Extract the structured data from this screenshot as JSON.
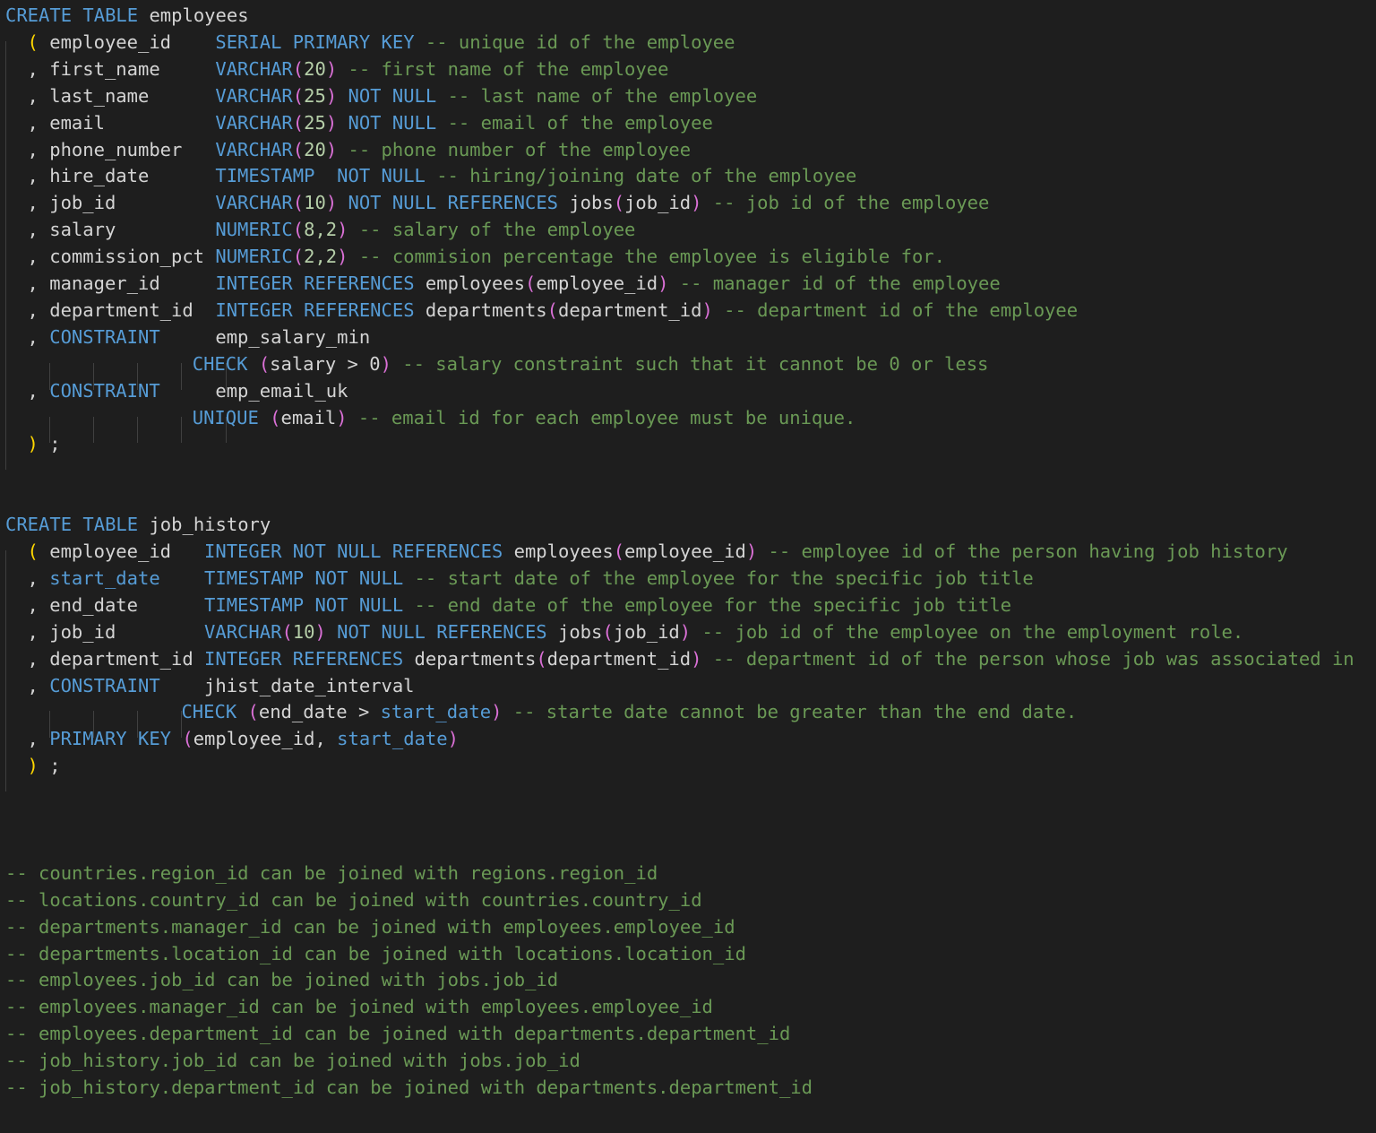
{
  "editor": {
    "language": "sql",
    "colors": {
      "background": "#1e1e1e",
      "keyword": "#569cd6",
      "identifier": "#d4d4d4",
      "number": "#b5cea8",
      "bracket_outer": "#ffd700",
      "bracket_inner": "#da70d6",
      "comment": "#6a9955",
      "indent_guide": "#404040"
    },
    "lines": [
      {
        "row": 0,
        "indent": 0,
        "tokens": [
          {
            "t": "CREATE TABLE",
            "c": "kw"
          },
          {
            "t": " employees",
            "c": "id"
          }
        ]
      },
      {
        "row": 1,
        "indent": 2,
        "tokens": [
          {
            "t": "( ",
            "c": "pb"
          },
          {
            "t": "employee_id    ",
            "c": "id"
          },
          {
            "t": "SERIAL PRIMARY KEY",
            "c": "kw"
          },
          {
            "t": " -- unique id of the employee",
            "c": "cm"
          }
        ]
      },
      {
        "row": 2,
        "indent": 2,
        "tokens": [
          {
            "t": ", ",
            "c": "pn"
          },
          {
            "t": "first_name     ",
            "c": "id"
          },
          {
            "t": "VARCHAR",
            "c": "kw"
          },
          {
            "t": "(",
            "c": "pp"
          },
          {
            "t": "20",
            "c": "nm"
          },
          {
            "t": ")",
            "c": "pp"
          },
          {
            "t": " -- first name of the employee",
            "c": "cm"
          }
        ]
      },
      {
        "row": 3,
        "indent": 2,
        "tokens": [
          {
            "t": ", ",
            "c": "pn"
          },
          {
            "t": "last_name      ",
            "c": "id"
          },
          {
            "t": "VARCHAR",
            "c": "kw"
          },
          {
            "t": "(",
            "c": "pp"
          },
          {
            "t": "25",
            "c": "nm"
          },
          {
            "t": ")",
            "c": "pp"
          },
          {
            "t": " NOT NULL",
            "c": "kw"
          },
          {
            "t": " -- last name of the employee",
            "c": "cm"
          }
        ]
      },
      {
        "row": 4,
        "indent": 2,
        "tokens": [
          {
            "t": ", ",
            "c": "pn"
          },
          {
            "t": "email          ",
            "c": "id"
          },
          {
            "t": "VARCHAR",
            "c": "kw"
          },
          {
            "t": "(",
            "c": "pp"
          },
          {
            "t": "25",
            "c": "nm"
          },
          {
            "t": ")",
            "c": "pp"
          },
          {
            "t": " NOT NULL",
            "c": "kw"
          },
          {
            "t": " -- email of the employee",
            "c": "cm"
          }
        ]
      },
      {
        "row": 5,
        "indent": 2,
        "tokens": [
          {
            "t": ", ",
            "c": "pn"
          },
          {
            "t": "phone_number   ",
            "c": "id"
          },
          {
            "t": "VARCHAR",
            "c": "kw"
          },
          {
            "t": "(",
            "c": "pp"
          },
          {
            "t": "20",
            "c": "nm"
          },
          {
            "t": ")",
            "c": "pp"
          },
          {
            "t": " -- phone number of the employee",
            "c": "cm"
          }
        ]
      },
      {
        "row": 6,
        "indent": 2,
        "tokens": [
          {
            "t": ", ",
            "c": "pn"
          },
          {
            "t": "hire_date      ",
            "c": "id"
          },
          {
            "t": "TIMESTAMP  NOT NULL",
            "c": "kw"
          },
          {
            "t": " -- hiring/joining date of the employee",
            "c": "cm"
          }
        ]
      },
      {
        "row": 7,
        "indent": 2,
        "tokens": [
          {
            "t": ", ",
            "c": "pn"
          },
          {
            "t": "job_id         ",
            "c": "id"
          },
          {
            "t": "VARCHAR",
            "c": "kw"
          },
          {
            "t": "(",
            "c": "pp"
          },
          {
            "t": "10",
            "c": "nm"
          },
          {
            "t": ")",
            "c": "pp"
          },
          {
            "t": " NOT NULL REFERENCES",
            "c": "kw"
          },
          {
            "t": " jobs",
            "c": "id"
          },
          {
            "t": "(",
            "c": "pp"
          },
          {
            "t": "job_id",
            "c": "id"
          },
          {
            "t": ")",
            "c": "pp"
          },
          {
            "t": " -- job id of the employee",
            "c": "cm"
          }
        ]
      },
      {
        "row": 8,
        "indent": 2,
        "tokens": [
          {
            "t": ", ",
            "c": "pn"
          },
          {
            "t": "salary         ",
            "c": "id"
          },
          {
            "t": "NUMERIC",
            "c": "kw"
          },
          {
            "t": "(",
            "c": "pp"
          },
          {
            "t": "8,2",
            "c": "nm"
          },
          {
            "t": ")",
            "c": "pp"
          },
          {
            "t": " -- salary of the employee",
            "c": "cm"
          }
        ]
      },
      {
        "row": 9,
        "indent": 2,
        "tokens": [
          {
            "t": ", ",
            "c": "pn"
          },
          {
            "t": "commission_pct ",
            "c": "id"
          },
          {
            "t": "NUMERIC",
            "c": "kw"
          },
          {
            "t": "(",
            "c": "pp"
          },
          {
            "t": "2,2",
            "c": "nm"
          },
          {
            "t": ")",
            "c": "pp"
          },
          {
            "t": " -- commision percentage the employee is eligible for.",
            "c": "cm"
          }
        ]
      },
      {
        "row": 10,
        "indent": 2,
        "tokens": [
          {
            "t": ", ",
            "c": "pn"
          },
          {
            "t": "manager_id     ",
            "c": "id"
          },
          {
            "t": "INTEGER REFERENCES",
            "c": "kw"
          },
          {
            "t": " employees",
            "c": "id"
          },
          {
            "t": "(",
            "c": "pp"
          },
          {
            "t": "employee_id",
            "c": "id"
          },
          {
            "t": ")",
            "c": "pp"
          },
          {
            "t": " -- manager id of the employee",
            "c": "cm"
          }
        ]
      },
      {
        "row": 11,
        "indent": 2,
        "tokens": [
          {
            "t": ", ",
            "c": "pn"
          },
          {
            "t": "department_id  ",
            "c": "id"
          },
          {
            "t": "INTEGER REFERENCES",
            "c": "kw"
          },
          {
            "t": " departments",
            "c": "id"
          },
          {
            "t": "(",
            "c": "pp"
          },
          {
            "t": "department_id",
            "c": "id"
          },
          {
            "t": ")",
            "c": "pp"
          },
          {
            "t": " -- department id of the employee",
            "c": "cm"
          }
        ]
      },
      {
        "row": 12,
        "indent": 2,
        "tokens": [
          {
            "t": ", ",
            "c": "pn"
          },
          {
            "t": "CONSTRAINT",
            "c": "kw"
          },
          {
            "t": "     emp_salary_min",
            "c": "id"
          }
        ]
      },
      {
        "row": 13,
        "indent": 17,
        "tokens": [
          {
            "t": "CHECK",
            "c": "kw"
          },
          {
            "t": " ",
            "c": "id"
          },
          {
            "t": "(",
            "c": "pp"
          },
          {
            "t": "salary > 0",
            "c": "id"
          },
          {
            "t": ")",
            "c": "pp"
          },
          {
            "t": " -- salary constraint such that it cannot be 0 or less",
            "c": "cm"
          }
        ]
      },
      {
        "row": 14,
        "indent": 2,
        "tokens": [
          {
            "t": ", ",
            "c": "pn"
          },
          {
            "t": "CONSTRAINT",
            "c": "kw"
          },
          {
            "t": "     emp_email_uk",
            "c": "id"
          }
        ]
      },
      {
        "row": 15,
        "indent": 17,
        "tokens": [
          {
            "t": "UNIQUE",
            "c": "kw"
          },
          {
            "t": " ",
            "c": "id"
          },
          {
            "t": "(",
            "c": "pp"
          },
          {
            "t": "email",
            "c": "id"
          },
          {
            "t": ")",
            "c": "pp"
          },
          {
            "t": " -- email id for each employee must be unique.",
            "c": "cm"
          }
        ]
      },
      {
        "row": 16,
        "indent": 2,
        "tokens": [
          {
            "t": ")",
            "c": "pb"
          },
          {
            "t": " ;",
            "c": "pn"
          }
        ]
      },
      {
        "row": 19,
        "indent": 0,
        "tokens": [
          {
            "t": "CREATE TABLE",
            "c": "kw"
          },
          {
            "t": " job_history",
            "c": "id"
          }
        ]
      },
      {
        "row": 20,
        "indent": 2,
        "tokens": [
          {
            "t": "( ",
            "c": "pb"
          },
          {
            "t": "employee_id   ",
            "c": "id"
          },
          {
            "t": "INTEGER NOT NULL REFERENCES",
            "c": "kw"
          },
          {
            "t": " employees",
            "c": "id"
          },
          {
            "t": "(",
            "c": "pp"
          },
          {
            "t": "employee_id",
            "c": "id"
          },
          {
            "t": ")",
            "c": "pp"
          },
          {
            "t": " -- employee id of the person having job history",
            "c": "cm"
          }
        ]
      },
      {
        "row": 21,
        "indent": 2,
        "tokens": [
          {
            "t": ", ",
            "c": "pn"
          },
          {
            "t": "start_date",
            "c": "kw"
          },
          {
            "t": "    ",
            "c": "id"
          },
          {
            "t": "TIMESTAMP NOT NULL",
            "c": "kw"
          },
          {
            "t": " -- start date of the employee for the specific job title",
            "c": "cm"
          }
        ]
      },
      {
        "row": 22,
        "indent": 2,
        "tokens": [
          {
            "t": ", ",
            "c": "pn"
          },
          {
            "t": "end_date      ",
            "c": "id"
          },
          {
            "t": "TIMESTAMP NOT NULL",
            "c": "kw"
          },
          {
            "t": " -- end date of the employee for the specific job title",
            "c": "cm"
          }
        ]
      },
      {
        "row": 23,
        "indent": 2,
        "tokens": [
          {
            "t": ", ",
            "c": "pn"
          },
          {
            "t": "job_id        ",
            "c": "id"
          },
          {
            "t": "VARCHAR",
            "c": "kw"
          },
          {
            "t": "(",
            "c": "pp"
          },
          {
            "t": "10",
            "c": "nm"
          },
          {
            "t": ")",
            "c": "pp"
          },
          {
            "t": " NOT NULL REFERENCES",
            "c": "kw"
          },
          {
            "t": " jobs",
            "c": "id"
          },
          {
            "t": "(",
            "c": "pp"
          },
          {
            "t": "job_id",
            "c": "id"
          },
          {
            "t": ")",
            "c": "pp"
          },
          {
            "t": " -- job id of the employee on the employment role.",
            "c": "cm"
          }
        ]
      },
      {
        "row": 24,
        "indent": 2,
        "tokens": [
          {
            "t": ", ",
            "c": "pn"
          },
          {
            "t": "department_id ",
            "c": "id"
          },
          {
            "t": "INTEGER REFERENCES",
            "c": "kw"
          },
          {
            "t": " departments",
            "c": "id"
          },
          {
            "t": "(",
            "c": "pp"
          },
          {
            "t": "department_id",
            "c": "id"
          },
          {
            "t": ")",
            "c": "pp"
          },
          {
            "t": " -- department id of the person whose job was associated in",
            "c": "cm"
          }
        ]
      },
      {
        "row": 25,
        "indent": 2,
        "tokens": [
          {
            "t": ", ",
            "c": "pn"
          },
          {
            "t": "CONSTRAINT",
            "c": "kw"
          },
          {
            "t": "    jhist_date_interval",
            "c": "id"
          }
        ]
      },
      {
        "row": 26,
        "indent": 16,
        "tokens": [
          {
            "t": "CHECK",
            "c": "kw"
          },
          {
            "t": " ",
            "c": "id"
          },
          {
            "t": "(",
            "c": "pp"
          },
          {
            "t": "end_date > ",
            "c": "id"
          },
          {
            "t": "start_date",
            "c": "kw"
          },
          {
            "t": ")",
            "c": "pp"
          },
          {
            "t": " -- starte date cannot be greater than the end date.",
            "c": "cm"
          }
        ]
      },
      {
        "row": 27,
        "indent": 2,
        "tokens": [
          {
            "t": ", ",
            "c": "pn"
          },
          {
            "t": "PRIMARY KEY",
            "c": "kw"
          },
          {
            "t": " ",
            "c": "id"
          },
          {
            "t": "(",
            "c": "pp"
          },
          {
            "t": "employee_id, ",
            "c": "id"
          },
          {
            "t": "start_date",
            "c": "kw"
          },
          {
            "t": ")",
            "c": "pp"
          }
        ]
      },
      {
        "row": 28,
        "indent": 2,
        "tokens": [
          {
            "t": ")",
            "c": "pb"
          },
          {
            "t": " ;",
            "c": "pn"
          }
        ]
      },
      {
        "row": 32,
        "indent": 0,
        "tokens": [
          {
            "t": "-- countries.region_id can be joined with regions.region_id",
            "c": "cm"
          }
        ]
      },
      {
        "row": 33,
        "indent": 0,
        "tokens": [
          {
            "t": "-- locations.country_id can be joined with countries.country_id",
            "c": "cm"
          }
        ]
      },
      {
        "row": 34,
        "indent": 0,
        "tokens": [
          {
            "t": "-- departments.manager_id can be joined with employees.employee_id",
            "c": "cm"
          }
        ]
      },
      {
        "row": 35,
        "indent": 0,
        "tokens": [
          {
            "t": "-- departments.location_id can be joined with locations.location_id",
            "c": "cm"
          }
        ]
      },
      {
        "row": 36,
        "indent": 0,
        "tokens": [
          {
            "t": "-- employees.job_id can be joined with jobs.job_id",
            "c": "cm"
          }
        ]
      },
      {
        "row": 37,
        "indent": 0,
        "tokens": [
          {
            "t": "-- employees.manager_id can be joined with employees.employee_id",
            "c": "cm"
          }
        ]
      },
      {
        "row": 38,
        "indent": 0,
        "tokens": [
          {
            "t": "-- employees.department_id can be joined with departments.department_id",
            "c": "cm"
          }
        ]
      },
      {
        "row": 39,
        "indent": 0,
        "tokens": [
          {
            "t": "-- job_history.job_id can be joined with jobs.job_id",
            "c": "cm"
          }
        ]
      },
      {
        "row": 40,
        "indent": 0,
        "tokens": [
          {
            "t": "-- job_history.department_id can be joined with departments.department_id",
            "c": "cm"
          }
        ]
      }
    ]
  }
}
